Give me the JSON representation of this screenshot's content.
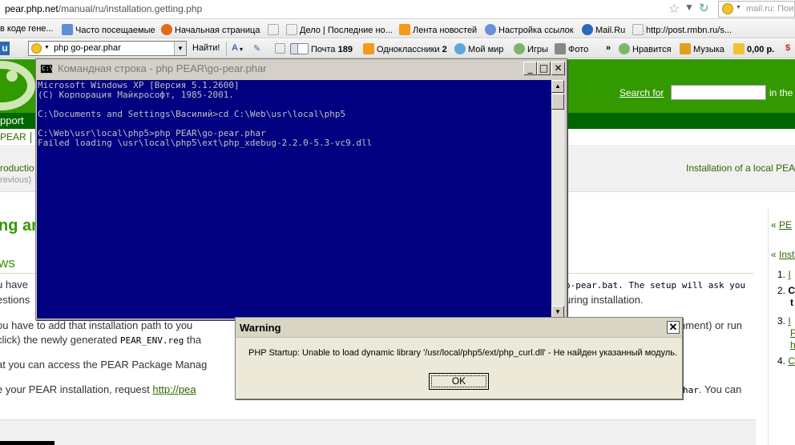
{
  "browser": {
    "url_prefix": "pear.php.net",
    "url_rest": "/manual/ru/installation.getting.php",
    "search_placeholder": "mail.ru: Пои"
  },
  "bookmarks": [
    {
      "label": "в коде гене...",
      "icon_color": "#ffffff"
    },
    {
      "label": "Часто посещаемые",
      "icon_color": "#5b8fd6"
    },
    {
      "label": "Начальная страница",
      "icon_color": "#e66a1a"
    },
    {
      "label": "",
      "icon_color": "#ffffff"
    },
    {
      "label": "Дело | Последние но...",
      "icon_color": "#ffffff"
    },
    {
      "label": "Лента новостей",
      "icon_color": "#f49a1a"
    },
    {
      "label": "Настройка ссылок",
      "icon_color": "#6a8fd6"
    },
    {
      "label": "Mail.Ru",
      "icon_color": "#2a6ab8"
    },
    {
      "label": "http://post.rmbn.ru/s...",
      "icon_color": "#ffffff"
    }
  ],
  "toolbar": {
    "u_label": "u",
    "search_value": "php go-pear.phar",
    "find_label": "Найти!",
    "mail_label": "Почта",
    "mail_count": "189",
    "ok_label": "Одноклассники",
    "ok_count": "2",
    "world_label": "Мой мир",
    "games_label": "Игры",
    "photo_label": "Фото",
    "more_label": "»",
    "likes_label": "Нравится",
    "music_label": "Музыка",
    "money_label": "0,00 р."
  },
  "page": {
    "search_for": "Search for",
    "in_the": "in the",
    "nav_support": "pport",
    "sub_pear": "PEAR",
    "crumb_prev": "roductio",
    "crumb_prev_sub": "revious)",
    "crumb_next": "Installation of a local PEAR",
    "h1": "ng an",
    "h2": "ws",
    "lines": [
      {
        "left": "u have",
        "right": "o-pear.bat. The setup will ask you"
      },
      {
        "left": "estions",
        "right": "uring installation."
      },
      {
        "left": "ou have to add that installation path to you",
        "right": "nment) or run"
      },
      {
        "left": "click) the newly generated ",
        "code": "PEAR_ENV.reg",
        "tail": " tha"
      },
      {
        "left": "at you can access the PEAR Package Manag"
      },
      {
        "left": "e your PEAR installation, request ",
        "link": "http://pea",
        "right_code": "har",
        "right": ". You can"
      }
    ],
    "sidebar": [
      {
        "prefix": "«",
        "label": "PE"
      },
      {
        "prefix": "«",
        "label": "Insta"
      }
    ],
    "sidebar_numbers": [
      {
        "num": "1.",
        "label": "I"
      },
      {
        "num": "2.",
        "label": "C",
        "extra": "t"
      },
      {
        "num": "3.",
        "label": "I",
        "extra2": "P",
        "extra3": "h"
      },
      {
        "num": "4.",
        "label": "C"
      }
    ]
  },
  "cmd": {
    "title": "Командная строка - php PEAR\\go-pear.phar",
    "icon_text": "C:\\",
    "lines": [
      "Microsoft Windows XP [Версия 5.1.2600]",
      "(С) Корпорация Майкрософт, 1985-2001.",
      "",
      "C:\\Documents and Settings\\Василий>cd C:\\Web\\usr\\local\\php5",
      "",
      "C:\\Web\\usr\\local\\php5>php PEAR\\go-pear.phar",
      "Failed loading \\usr\\local\\php5\\ext\\php_xdebug-2.2.0-5.3-vc9.dll"
    ],
    "btn_minimize": "_",
    "btn_maximize": "□",
    "btn_close": "✕",
    "scroll_up": "▲",
    "scroll_down": "▼"
  },
  "dialog": {
    "title": "Warning",
    "message": "PHP Startup: Unable to load dynamic library '/usr/local/php5/ext/php_curl.dll' - Не найден указанный модуль.",
    "ok_label": "OK",
    "close_label": "✕"
  },
  "colors": {
    "pear_green": "#339900",
    "pear_dark_green": "#006600",
    "console_bg": "#000080",
    "console_fg": "#c0c0c0"
  }
}
